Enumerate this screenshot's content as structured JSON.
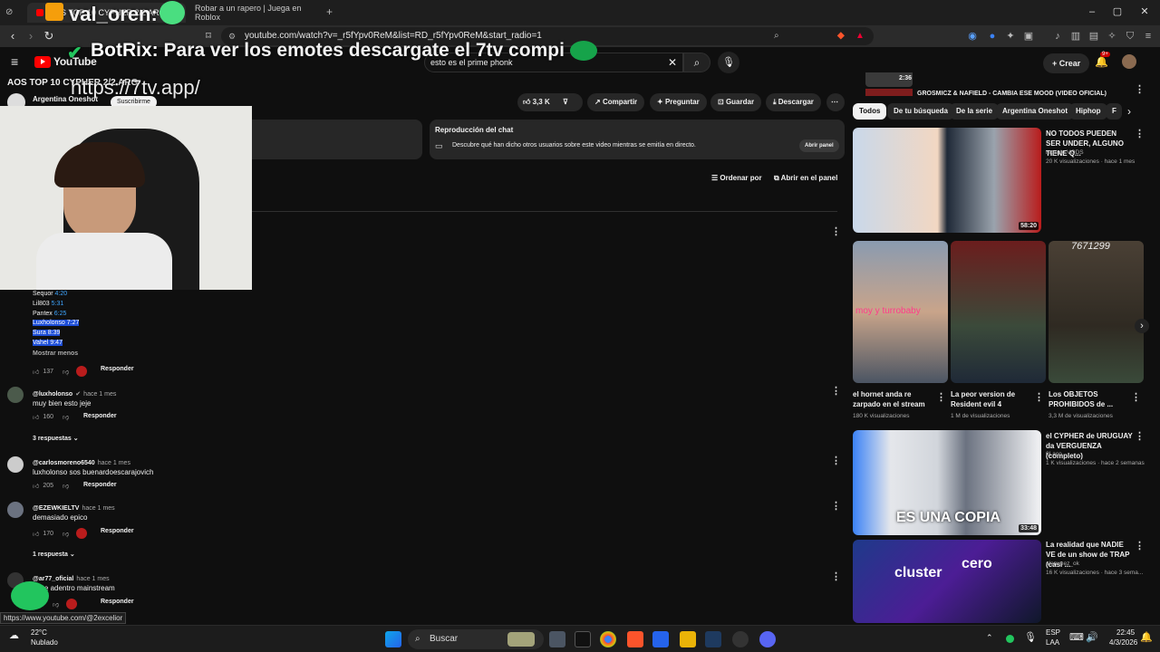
{
  "browser": {
    "tabs": [
      {
        "label": "AOS TOP 10 CYPHER 2/2 ARG"
      },
      {
        "label": "Robar a un rapero | Juega en Roblox"
      }
    ],
    "new_tab": "+",
    "url": "youtube.com/watch?v=_r5fYpv0ReM&list=RD_r5fYpv0ReM&start_radio=1",
    "status_url": "https://www.youtube.com/@2excelior"
  },
  "overlay": {
    "line1_user": "val_oren:",
    "line2_user": "BotRix:",
    "line2_text": "Para ver los emotes descargate el 7tv compi",
    "line3_text": "https://7tv.app/"
  },
  "youtube": {
    "logo": "YouTube",
    "search_value": "esto es el prime phonk",
    "create_label": "Crear",
    "notif_count": "9+",
    "video_title": "AOS TOP 10 CYPHER 2/2 ARG",
    "channel": "Argentina Oneshot",
    "subscribe": "Suscribirme",
    "likes": "3,3 K",
    "share": "Compartir",
    "ask": "Preguntar",
    "save": "Guardar",
    "download": "Descargar",
    "chat_title": "Reproducción del chat",
    "chat_desc": "Descubre qué han dicho otros usuarios sobre este video mientras se emitía en directo.",
    "open_panel": "Abrir panel",
    "sort_by": "Ordenar por",
    "open_in_panel": "Abrir en el panel"
  },
  "first_comment": {
    "timestamps": [
      {
        "name": "Sequor",
        "time": "4:20",
        "highlight": false
      },
      {
        "name": "Lil803",
        "time": "5:31",
        "highlight": false
      },
      {
        "name": "Pantex",
        "time": "6:25",
        "highlight": false
      },
      {
        "name": "Luxholonso",
        "time": "7:27",
        "highlight": true
      },
      {
        "name": "Sura",
        "time": "8:39",
        "highlight": true
      },
      {
        "name": "Vahel",
        "time": "9:47",
        "highlight": true
      }
    ],
    "show_less": "Mostrar menos",
    "likes": "137",
    "reply": "Responder"
  },
  "comments": [
    {
      "handle": "@luxholonso",
      "time": "hace 1 mes",
      "text": "muy bien esto jeje",
      "likes": "160",
      "reply": "Responder",
      "replies": "3 respuestas"
    },
    {
      "handle": "@carlosmoreno6540",
      "time": "hace 1 mes",
      "text": "luxholonso sos buenardoescarajovich",
      "likes": "205",
      "reply": "Responder",
      "replies": ""
    },
    {
      "handle": "@EZEWKIELTV",
      "time": "hace 1 mes",
      "text": "demasiado epico",
      "likes": "170",
      "reply": "Responder",
      "replies": "1 respuesta"
    },
    {
      "handle": "@ar77_oficial",
      "time": "hace 1 mes",
      "text": "tiene adentro mainstream",
      "likes": "",
      "reply": "Responder",
      "replies": ""
    }
  ],
  "sidebar": {
    "top_dur": "2:36",
    "top_title": "GROSMICZ & NAFIELD - CAMBIA ESE MOOD (VIDEO OFICIAL)",
    "chips": [
      "Todos",
      "De tu búsqueda",
      "De la serie",
      "Argentina Oneshot",
      "Hiphop",
      "F"
    ],
    "video1": {
      "title": "NO TODOS PUEDEN SER UNDER, ALGUNO TIENE Q...",
      "channel": "rageylo VODS",
      "meta": "20 K visualizaciones · hace 1 mes",
      "duration": "58:20"
    },
    "shorts": [
      {
        "title": "el hornet anda re zarpado en el stream",
        "views": "180 K visualizaciones",
        "overlay": "moy y turrobaby"
      },
      {
        "title": "La peor version de Resident evil 4",
        "views": "1 M de visualizaciones",
        "overlay": ""
      },
      {
        "title": "Los OBJETOS PROHIBIDOS de ...",
        "views": "3,3 M de visualizaciones",
        "overlay": "7671299"
      }
    ],
    "video2": {
      "title": "el CYPHER de URUGUAY da VERGUENZA (completo)",
      "channel": "0Laco",
      "meta": "1 K visualizaciones · hace 2 semanas",
      "duration": "33:48",
      "overlay": "ES UNA COPIA"
    },
    "video3": {
      "title": "La realidad que NADIE VE de un show de TRAP (casi ...",
      "channel": "alenunez_ok",
      "meta": "16 K visualizaciones · hace 3 sema...",
      "overlay1": "cluster",
      "overlay2": "cero"
    }
  },
  "taskbar": {
    "weather_temp": "22°C",
    "weather_desc": "Nublado",
    "search_label": "Buscar",
    "lang1": "ESP",
    "lang2": "LAA",
    "time": "22:45",
    "date": "4/3/2026"
  },
  "colors": {
    "accent": "#3ea6ff",
    "brand": "#ff0000",
    "bg": "#0f0f0f",
    "highlight": "#1d4ed8"
  }
}
